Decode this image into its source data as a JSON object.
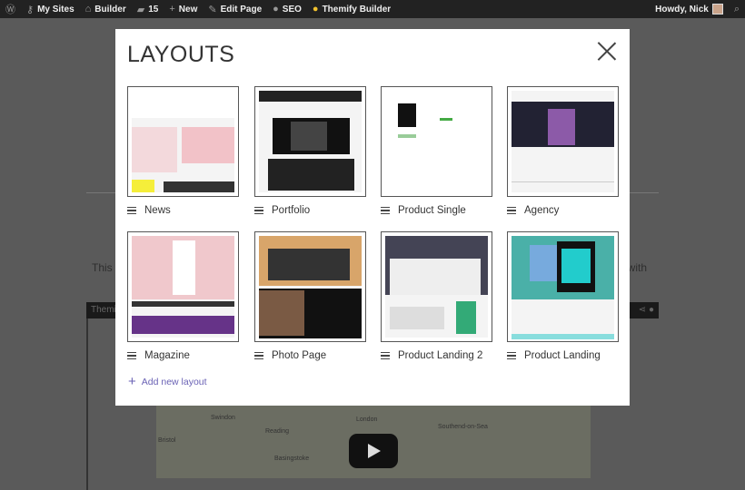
{
  "admin_bar": {
    "items": [
      {
        "icon": "wordpress-icon",
        "label": ""
      },
      {
        "icon": "key-icon",
        "label": "My Sites"
      },
      {
        "icon": "home-icon",
        "label": "Builder"
      },
      {
        "icon": "comment-icon",
        "label": "15"
      },
      {
        "icon": "plus-icon",
        "label": "New"
      },
      {
        "icon": "pencil-icon",
        "label": "Edit Page"
      },
      {
        "icon": "circle-icon",
        "label": "SEO"
      },
      {
        "icon": "themify-icon",
        "label": "Themify Builder"
      }
    ],
    "greeting": "Howdy, Nick"
  },
  "background": {
    "text_left": "This s",
    "text_right": "t with",
    "bar_label": "Themi",
    "map_labels": [
      "London",
      "Reading",
      "Swindon",
      "Bristol",
      "Southend-on-Sea",
      "Basingstoke"
    ]
  },
  "modal": {
    "title": "LAYOUTS",
    "layouts": [
      {
        "label": "News"
      },
      {
        "label": "Portfolio"
      },
      {
        "label": "Product Single"
      },
      {
        "label": "Agency"
      },
      {
        "label": "Magazine"
      },
      {
        "label": "Photo Page"
      },
      {
        "label": "Product Landing 2"
      },
      {
        "label": "Product Landing"
      }
    ],
    "add_label": "Add new layout"
  }
}
